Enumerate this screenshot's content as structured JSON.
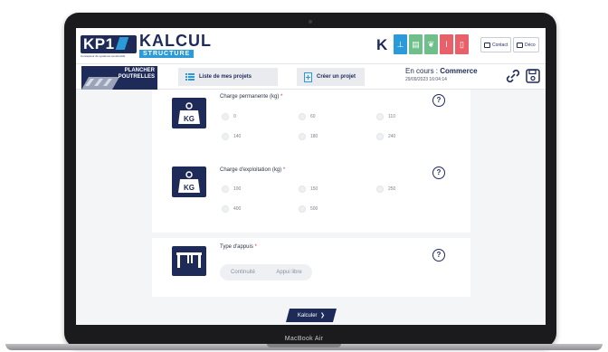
{
  "device": {
    "label": "MacBook Air"
  },
  "header": {
    "logo_kp1": "KP1",
    "logo_tagline": "Concepteur de systèmes constructifs",
    "logo_kalcul": "KALCUL",
    "logo_structure": "STRUCTURE",
    "logo_k": "K",
    "app_icons": [
      {
        "name": "structure-app-icon",
        "color": "#2b9ad8",
        "glyph": "⊥"
      },
      {
        "name": "document-app-icon",
        "color": "#6fbf8a",
        "glyph": "▤"
      },
      {
        "name": "leaf-app-icon",
        "color": "#6fbf8a",
        "glyph": "❦"
      },
      {
        "name": "thermometer-app-icon",
        "color": "#e8606a",
        "glyph": "🌡"
      },
      {
        "name": "book-app-icon",
        "color": "#e8606a",
        "glyph": "▯"
      }
    ],
    "contact_label": "Contact",
    "other_label": "Déco"
  },
  "subheader": {
    "product_title_line1": "PLANCHER",
    "product_title_line2": "POUTRELLES",
    "projects_label": "Liste de mes projets",
    "create_label": "Créer un projet",
    "status_prefix": "En cours :",
    "status_value": "Commerce",
    "status_date": "29/09/2023 16:04:14"
  },
  "sections": {
    "permanent": {
      "label": "Charge permanente (kg)",
      "required_mark": "*",
      "badge_text": "KG",
      "options": [
        "0",
        "60",
        "110",
        "140",
        "180",
        "240"
      ]
    },
    "exploitation": {
      "label": "Charge d'exploitation (kg)",
      "required_mark": "*",
      "badge_text": "KG",
      "options": [
        "100",
        "150",
        "250",
        "400",
        "500"
      ]
    },
    "support": {
      "label": "Type d'appuis",
      "required_mark": "*",
      "options": [
        "Continuité",
        "Appui libre"
      ]
    },
    "help_glyph": "?"
  },
  "footer": {
    "calculate_label": "Kalculer",
    "calculate_arrow": "❯"
  },
  "colors": {
    "navy": "#1e2b59",
    "accent": "#2b9ad8",
    "required": "#e0312d"
  }
}
